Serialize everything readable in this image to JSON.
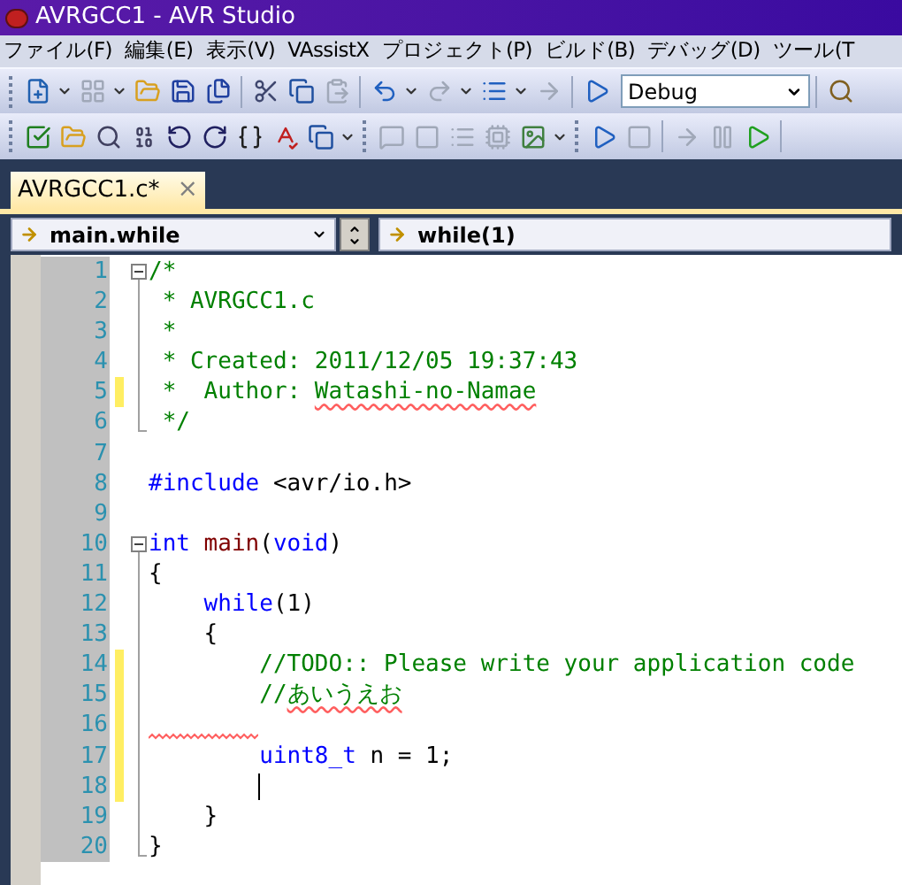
{
  "window": {
    "title": "AVRGCC1 - AVR Studio"
  },
  "menu": [
    "ファイル(F)",
    "編集(E)",
    "表示(V)",
    "VAssistX",
    "プロジェクト(P)",
    "ビルド(B)",
    "デバッグ(D)",
    "ツール(T"
  ],
  "toolbar": {
    "configuration": "Debug"
  },
  "tabs": [
    {
      "label": "AVRGCC1.c*",
      "selected": true,
      "close": "×"
    }
  ],
  "navigation": {
    "scope": "main.while",
    "member": "while(1)"
  },
  "editor": {
    "lines": [
      {
        "number": "1",
        "fold_toggle": true,
        "segments": [
          {
            "kind": "comment",
            "text": "/*"
          }
        ]
      },
      {
        "number": "2",
        "fold_guide": true,
        "segments": [
          {
            "kind": "comment",
            "text": " * AVRGCC1.c"
          }
        ]
      },
      {
        "number": "3",
        "fold_guide": true,
        "segments": [
          {
            "kind": "comment",
            "text": " *"
          }
        ]
      },
      {
        "number": "4",
        "fold_guide": true,
        "segments": [
          {
            "kind": "comment",
            "text": " * Created: 2011/12/05 19:37:43"
          }
        ]
      },
      {
        "number": "5",
        "changed": true,
        "fold_guide": true,
        "segments": [
          {
            "kind": "comment",
            "text": " *  Author: "
          },
          {
            "kind": "comment",
            "text": "Watashi-no-Namae",
            "misspelled": true
          }
        ]
      },
      {
        "number": "6",
        "fold_end": true,
        "segments": [
          {
            "kind": "comment",
            "text": " */"
          }
        ]
      },
      {
        "number": "7"
      },
      {
        "number": "8",
        "segments": [
          {
            "kind": "keyword",
            "text": "#include"
          },
          {
            "kind": "plain",
            "text": " <avr/io.h>"
          }
        ]
      },
      {
        "number": "9"
      },
      {
        "number": "10",
        "fold_toggle": true,
        "segments": [
          {
            "kind": "keyword",
            "text": "int"
          },
          {
            "kind": "function",
            "text": " main"
          },
          {
            "kind": "plain",
            "text": "("
          },
          {
            "kind": "keyword",
            "text": "void"
          },
          {
            "kind": "plain",
            "text": ")"
          }
        ]
      },
      {
        "number": "11",
        "fold_guide": true,
        "segments": [
          {
            "kind": "plain",
            "text": "{"
          }
        ]
      },
      {
        "number": "12",
        "fold_guide": true,
        "segments": [
          {
            "kind": "keyword",
            "text": "    while"
          },
          {
            "kind": "plain",
            "text": "(1)"
          }
        ]
      },
      {
        "number": "13",
        "fold_guide": true,
        "segments": [
          {
            "kind": "plain",
            "text": "    {"
          }
        ]
      },
      {
        "number": "14",
        "changed": true,
        "fold_guide": true,
        "segments": [
          {
            "kind": "comment",
            "text": "        //TODO:: Please write your application code"
          }
        ]
      },
      {
        "number": "15",
        "changed": true,
        "fold_guide": true,
        "segments": [
          {
            "kind": "comment",
            "text": "        //"
          },
          {
            "kind": "comment",
            "text": "あいうえお",
            "misspelled": true
          }
        ]
      },
      {
        "number": "16",
        "changed": true,
        "fold_guide": true,
        "squiggle": true
      },
      {
        "number": "17",
        "changed": true,
        "fold_guide": true,
        "segments": [
          {
            "kind": "keyword",
            "text": "        uint8_t"
          },
          {
            "kind": "plain",
            "text": " n = 1;"
          }
        ]
      },
      {
        "number": "18",
        "changed": true,
        "fold_guide": true,
        "cursor": true
      },
      {
        "number": "19",
        "fold_guide": true,
        "segments": [
          {
            "kind": "plain",
            "text": "    }"
          }
        ]
      },
      {
        "number": "20",
        "fold_end": true,
        "segments": [
          {
            "kind": "plain",
            "text": "}"
          }
        ]
      }
    ]
  }
}
